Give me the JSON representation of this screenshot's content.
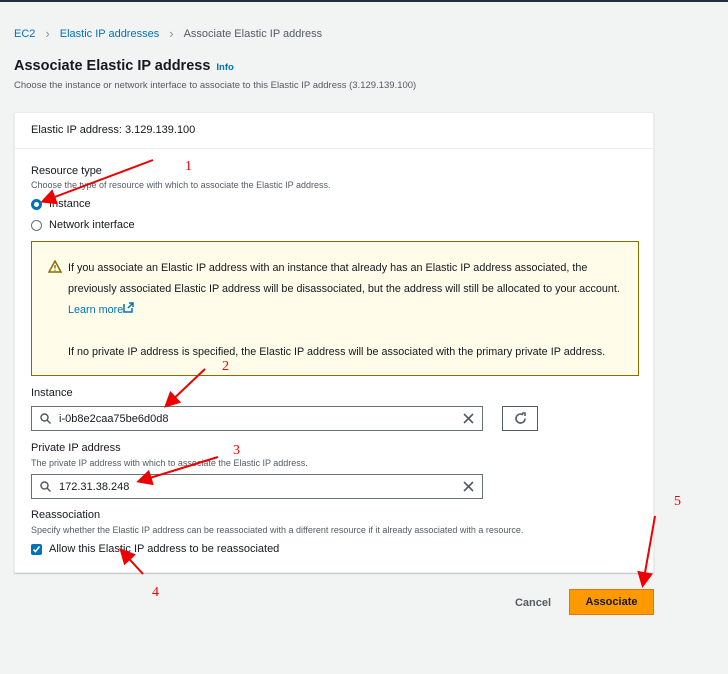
{
  "breadcrumb": [
    "EC2",
    "Elastic IP addresses",
    "Associate Elastic IP address"
  ],
  "page": {
    "title": "Associate Elastic IP address",
    "info": "Info",
    "description": "Choose the instance or network interface to associate to this Elastic IP address (3.129.139.100)"
  },
  "panel": {
    "header": "Elastic IP address: 3.129.139.100",
    "resource_type": {
      "label": "Resource type",
      "description": "Choose the type of resource with which to associate the Elastic IP address.",
      "options": [
        "Instance",
        "Network interface"
      ],
      "selected": "Instance"
    },
    "alert": {
      "text1": "If you associate an Elastic IP address with an instance that already has an Elastic IP address associated, the previously associated Elastic IP address will be disassociated, but the address will still be allocated to your account.",
      "link": "Learn more",
      "text2": "If no private IP address is specified, the Elastic IP address will be associated with the primary private IP address."
    },
    "instance": {
      "label": "Instance",
      "value": "i-0b8e2caa75be6d0d8"
    },
    "private_ip": {
      "label": "Private IP address",
      "description": "The private IP address with which to associate the Elastic IP address.",
      "value": "172.31.38.248"
    },
    "reassociation": {
      "label": "Reassociation",
      "description": "Specify whether the Elastic IP address can be reassociated with a different resource if it already associated with a resource.",
      "checkbox_label": "Allow this Elastic IP address to be reassociated",
      "checked": true
    }
  },
  "actions": {
    "cancel": "Cancel",
    "associate": "Associate"
  },
  "annotations": [
    "1",
    "2",
    "3",
    "4",
    "5"
  ],
  "colors": {
    "accent": "#0073bb",
    "primary_button": "#ff9900",
    "annotation": "#ee0000"
  }
}
